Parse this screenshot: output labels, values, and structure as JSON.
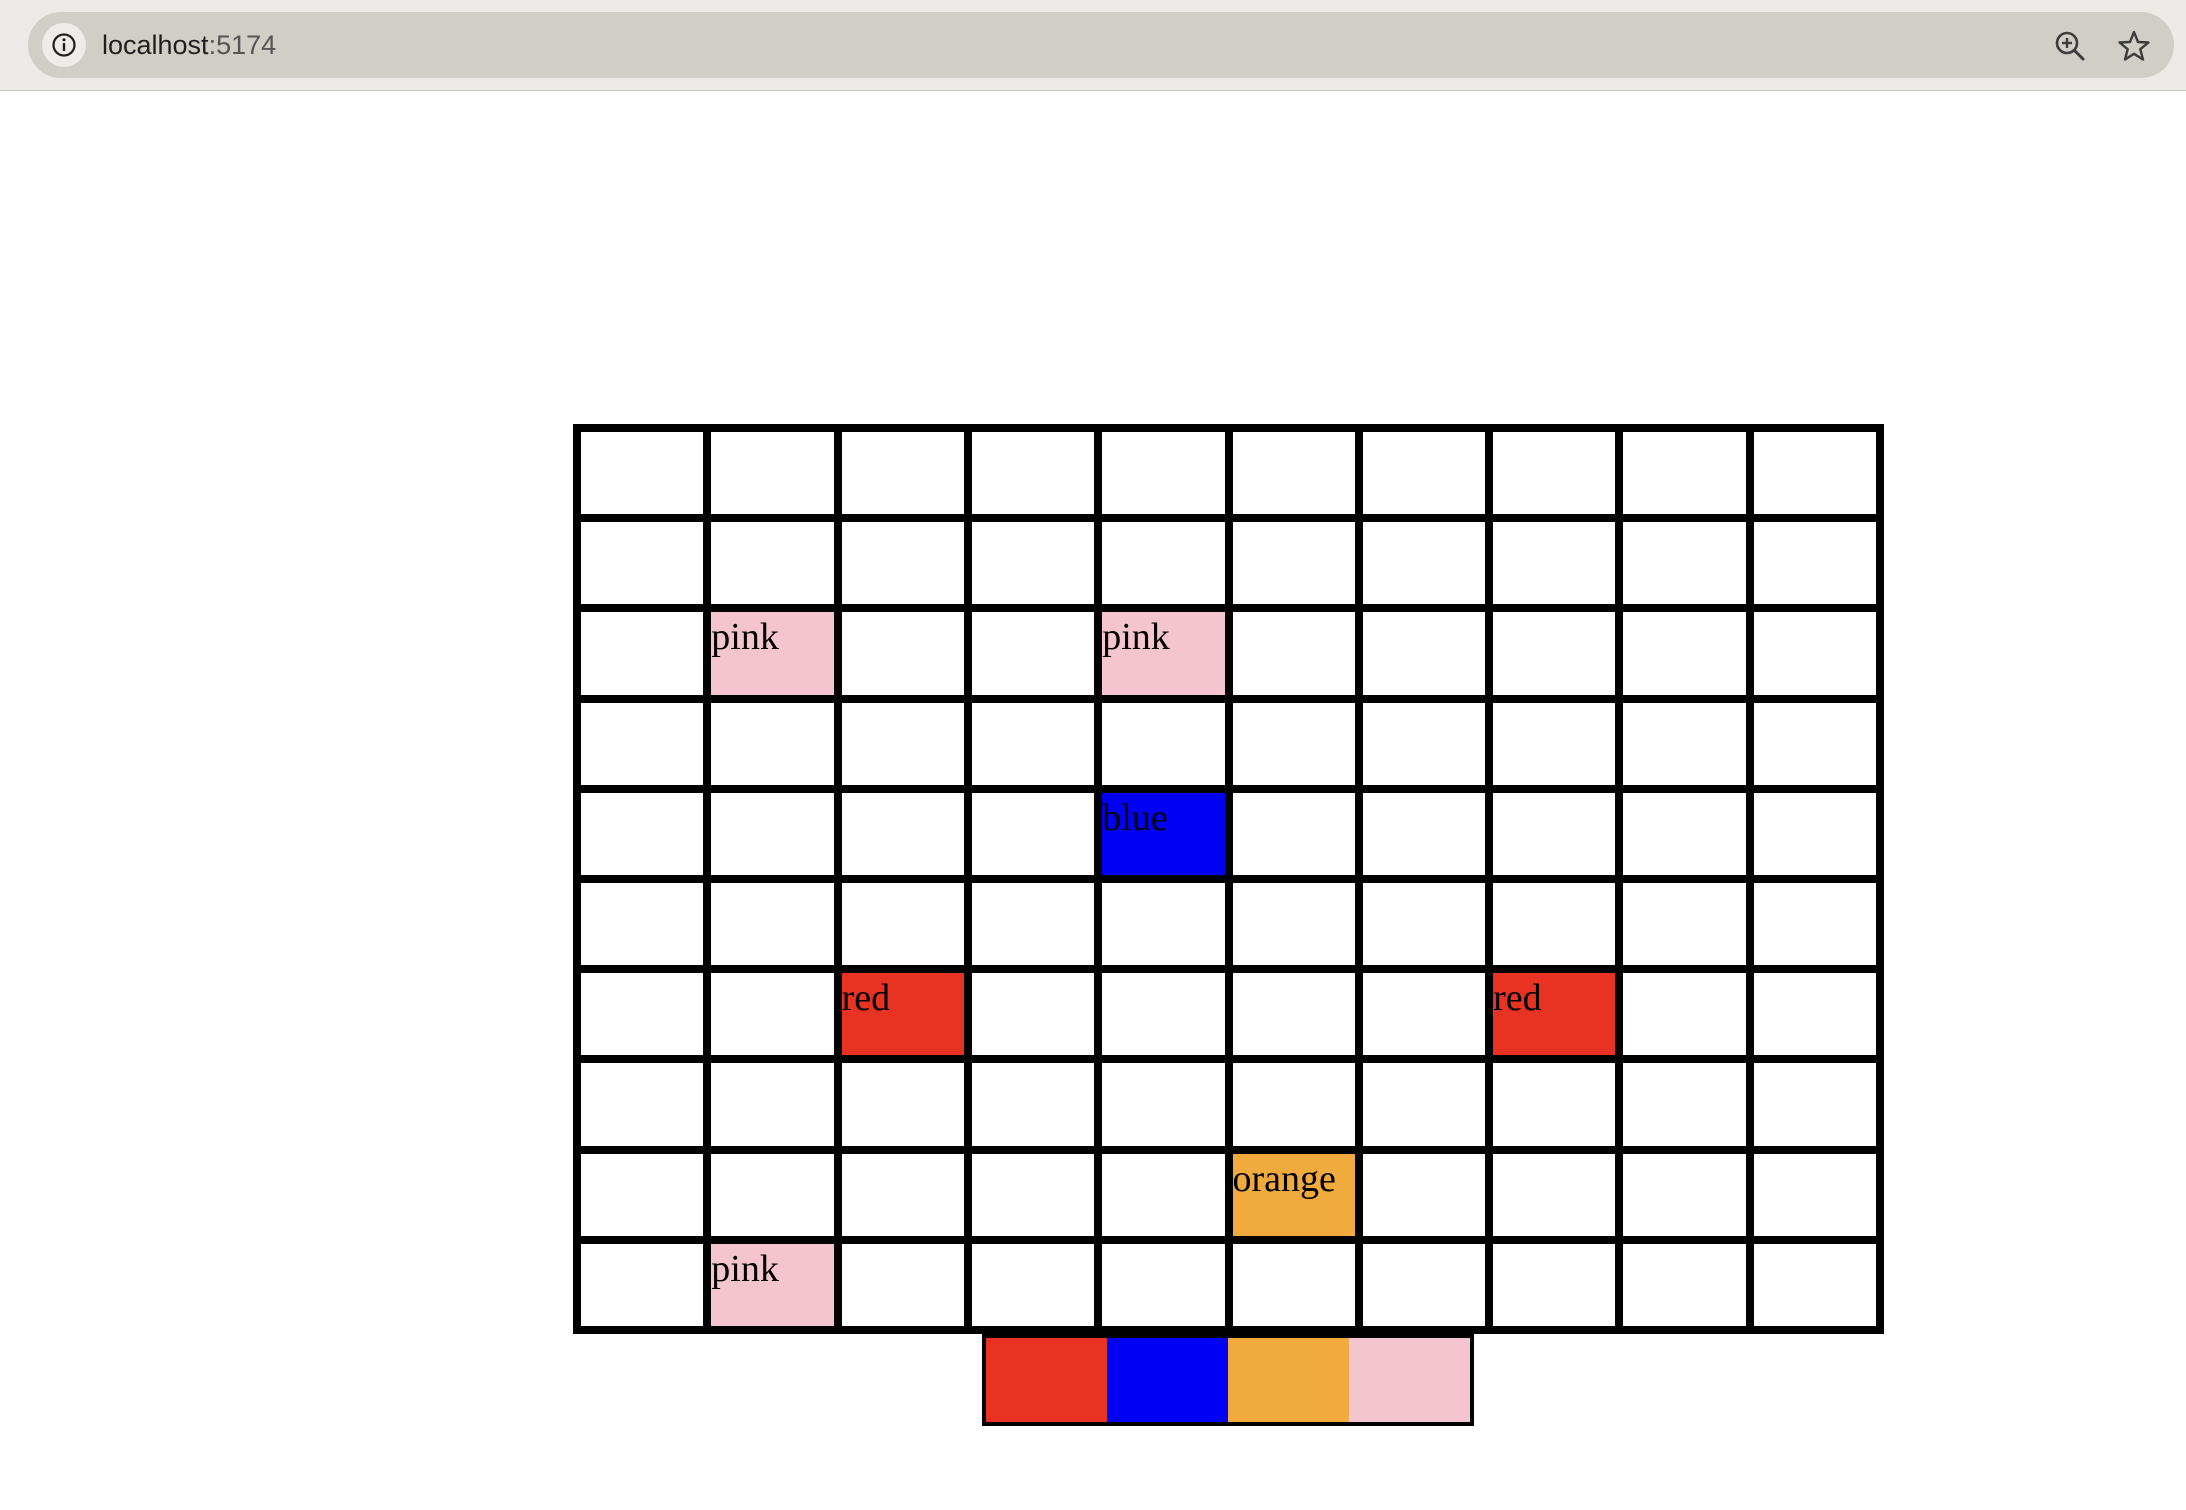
{
  "browser": {
    "url_host": "localhost",
    "url_port": ":5174",
    "icons": [
      "info-icon",
      "zoom-icon",
      "star-icon"
    ]
  },
  "board": {
    "rows": 10,
    "cols": 10,
    "empty_color": "#ffffff",
    "colors": {
      "pink": "#f4c5cf",
      "blue": "#0000f5",
      "red": "#e83322",
      "orange": "#f0aa3e"
    },
    "cells": [
      [
        "",
        "",
        "",
        "",
        "",
        "",
        "",
        "",
        "",
        ""
      ],
      [
        "",
        "",
        "",
        "",
        "",
        "",
        "",
        "",
        "",
        ""
      ],
      [
        "",
        "pink",
        "",
        "",
        "pink",
        "",
        "",
        "",
        "",
        ""
      ],
      [
        "",
        "",
        "",
        "",
        "",
        "",
        "",
        "",
        "",
        ""
      ],
      [
        "",
        "",
        "",
        "",
        "blue",
        "",
        "",
        "",
        "",
        ""
      ],
      [
        "",
        "",
        "",
        "",
        "",
        "",
        "",
        "",
        "",
        ""
      ],
      [
        "",
        "",
        "red",
        "",
        "",
        "",
        "",
        "red",
        "",
        ""
      ],
      [
        "",
        "",
        "",
        "",
        "",
        "",
        "",
        "",
        "",
        ""
      ],
      [
        "",
        "",
        "",
        "",
        "",
        "orange",
        "",
        "",
        "",
        ""
      ],
      [
        "",
        "pink",
        "",
        "",
        "",
        "",
        "",
        "",
        "",
        ""
      ]
    ]
  },
  "palette": {
    "swatches": [
      {
        "name": "red",
        "color": "#e83322"
      },
      {
        "name": "blue",
        "color": "#0000f5"
      },
      {
        "name": "orange",
        "color": "#f0aa3e"
      },
      {
        "name": "pink",
        "color": "#f4c5cf"
      }
    ]
  }
}
